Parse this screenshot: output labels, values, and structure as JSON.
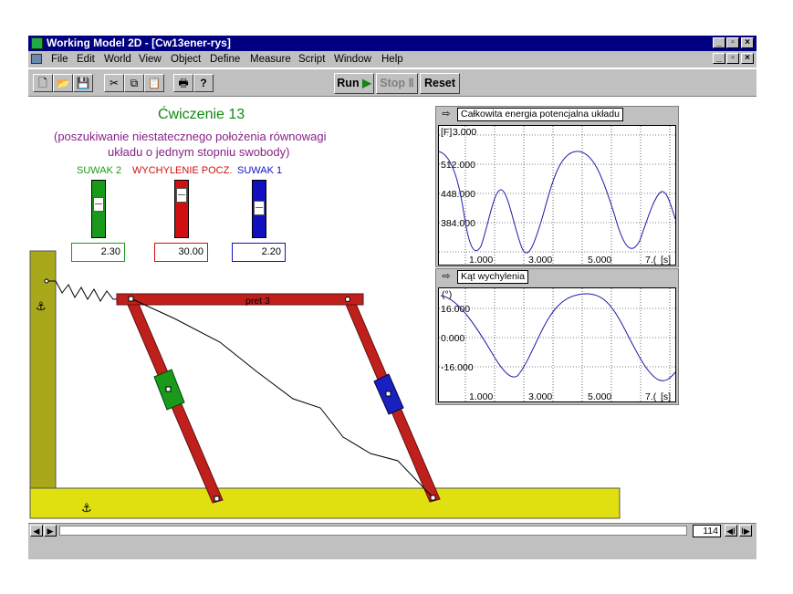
{
  "window": {
    "title": "Working Model 2D - [Cw13ener-rys]"
  },
  "menu": [
    "File",
    "Edit",
    "World",
    "View",
    "Object",
    "Define",
    "Measure",
    "Script",
    "Window",
    "Help"
  ],
  "toolbar": {
    "run_label": "Run",
    "stop_label": "Stop",
    "reset_label": "Reset"
  },
  "workspace": {
    "title": "Ćwiczenie 13",
    "subtitle_line1": "(poszukiwanie niestatecznego położenia równowagi",
    "subtitle_line2": "układu o jednym stopniu swobody)",
    "rod_label": "pret 3"
  },
  "sliders": [
    {
      "label": "SUWAK 2",
      "value": "2.30",
      "color": "#1a9a1a"
    },
    {
      "label": "WYCHYLENIE POCZ.",
      "value": "30.00",
      "color": "#d01010"
    },
    {
      "label": "SUWAK 1",
      "value": "2.20",
      "color": "#1010c0"
    }
  ],
  "graphs": [
    {
      "title": "Całkowita energia potencjalna układu",
      "ylabel": "[F]",
      "yticks": [
        "3.000",
        "512.000",
        "448.000",
        "384.000"
      ],
      "xticks": [
        "1.000",
        "3.000",
        "5.000",
        "7.("
      ],
      "xunit": "[s]"
    },
    {
      "title": "Kąt wychylenia",
      "ylabel": "(°)",
      "yticks": [
        "16.000",
        "0.000",
        "-16.000"
      ],
      "xticks": [
        "1.000",
        "3.000",
        "5.000",
        "7.("
      ],
      "xunit": "[s]"
    }
  ],
  "frame_counter": "114",
  "colors": {
    "titlebar": "#000080",
    "wall": "#a8a81a",
    "ground": "#e0e010",
    "rod": "#c0201c",
    "heading": "#118811",
    "subtitle": "#882288"
  }
}
